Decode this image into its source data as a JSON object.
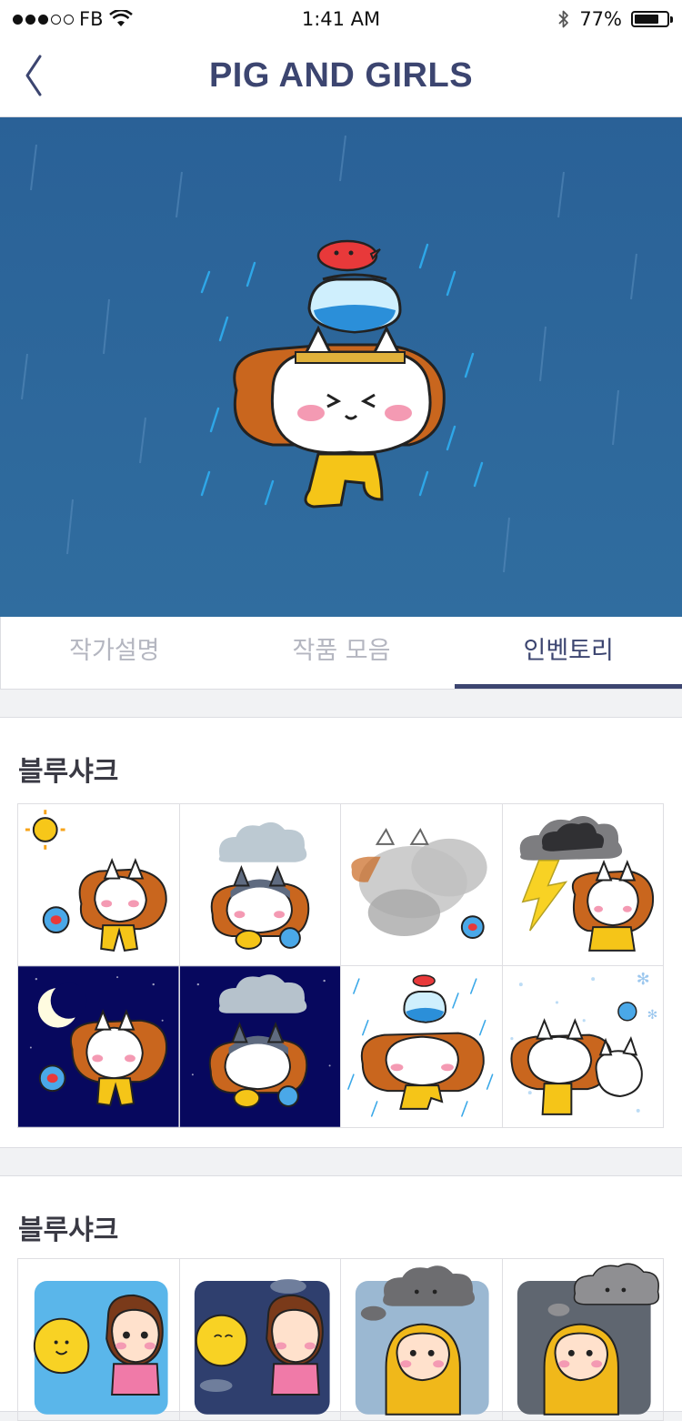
{
  "status_bar": {
    "carrier": "FB",
    "time": "1:41 AM",
    "battery_text": "77%",
    "battery_level": 0.77
  },
  "nav": {
    "title": "PIG AND GIRLS",
    "back_icon": "chevron-left-icon"
  },
  "tabs": [
    {
      "label": "작가설명",
      "active": false
    },
    {
      "label": "작품 모음",
      "active": false
    },
    {
      "label": "인벤토리",
      "active": true
    }
  ],
  "sections": [
    {
      "title": "블루샤크"
    },
    {
      "title": "블루샤크"
    }
  ],
  "colors": {
    "accent": "#3c4570",
    "hero_bg": "#2f6a9c",
    "night_bg": "#07085e",
    "inactive_tab": "#b4b6c0"
  }
}
